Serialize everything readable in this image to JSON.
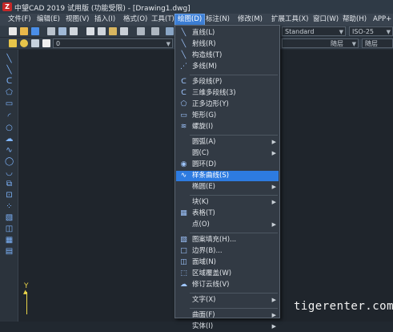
{
  "window": {
    "title": "中望CAD 2019 试用版 (功能受限) - [Drawing1.dwg]",
    "logo": "Z"
  },
  "menubar": [
    "文件(F)",
    "编辑(E)",
    "视图(V)",
    "插入(I)",
    "格式(O)",
    "工具(T)",
    "绘图(D)",
    "标注(N)",
    "修改(M)",
    "扩展工具(X)",
    "窗口(W)",
    "帮助(H)",
    "APP+"
  ],
  "toolbar": {
    "layer_value": "0",
    "text_style": "Standard",
    "dim_style": "ISO-25",
    "linetype": "随层",
    "lineweight": "随层"
  },
  "draw_menu": {
    "items": [
      {
        "label": "直线(L)",
        "icon": "line-icon",
        "glyph": "╲"
      },
      {
        "label": "射线(R)",
        "icon": "ray-icon",
        "glyph": "╲"
      },
      {
        "label": "构造线(T)",
        "icon": "xline-icon",
        "glyph": "╲"
      },
      {
        "label": "多线(M)",
        "icon": "mline-icon",
        "glyph": "⋰"
      },
      {
        "sep": true
      },
      {
        "label": "多段线(P)",
        "icon": "polyline-icon",
        "glyph": "ᑕ"
      },
      {
        "label": "三维多段线(3)",
        "icon": "3dpolyline-icon",
        "glyph": "ᑕ"
      },
      {
        "label": "正多边形(Y)",
        "icon": "polygon-icon",
        "glyph": "⬠"
      },
      {
        "label": "矩形(G)",
        "icon": "rectangle-icon",
        "glyph": "▭"
      },
      {
        "label": "螺旋(I)",
        "icon": "helix-icon",
        "glyph": "≋"
      },
      {
        "sep": true
      },
      {
        "label": "圆弧(A)",
        "icon": "",
        "glyph": "",
        "submenu": true
      },
      {
        "label": "圆(C)",
        "icon": "",
        "glyph": "",
        "submenu": true
      },
      {
        "label": "圆环(D)",
        "icon": "donut-icon",
        "glyph": "◉"
      },
      {
        "label": "样条曲线(S)",
        "icon": "spline-icon",
        "glyph": "∿",
        "highlight": true
      },
      {
        "label": "椭圆(E)",
        "icon": "",
        "glyph": "",
        "submenu": true
      },
      {
        "sep": true
      },
      {
        "label": "块(K)",
        "icon": "",
        "glyph": "",
        "submenu": true
      },
      {
        "label": "表格(T)",
        "icon": "table-icon",
        "glyph": "▦"
      },
      {
        "label": "点(O)",
        "icon": "",
        "glyph": "",
        "submenu": true
      },
      {
        "sep": true
      },
      {
        "label": "图案填充(H)...",
        "icon": "hatch-icon",
        "glyph": "▧"
      },
      {
        "label": "边界(B)...",
        "icon": "boundary-icon",
        "glyph": "□"
      },
      {
        "label": "面域(N)",
        "icon": "region-icon",
        "glyph": "◫"
      },
      {
        "label": "区域覆盖(W)",
        "icon": "wipeout-icon",
        "glyph": "⬚"
      },
      {
        "label": "修订云线(V)",
        "icon": "revcloud-icon",
        "glyph": "☁"
      },
      {
        "sep": true
      },
      {
        "label": "文字(X)",
        "icon": "",
        "glyph": "",
        "submenu": true
      },
      {
        "sep": true
      },
      {
        "label": "曲面(F)",
        "icon": "",
        "glyph": "",
        "submenu": true
      },
      {
        "label": "实体(I)",
        "icon": "",
        "glyph": "",
        "submenu": true
      }
    ]
  },
  "canvas": {
    "ucs_label": "Y"
  },
  "watermark": "tigerenter.com"
}
